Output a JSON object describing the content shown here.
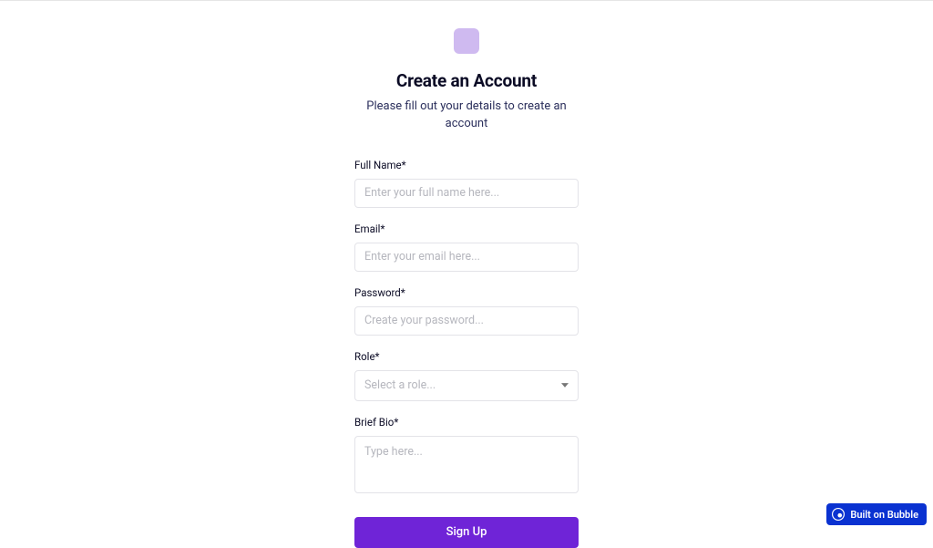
{
  "header": {
    "title": "Create an Account",
    "subtitle": "Please fill out your details to create an account"
  },
  "form": {
    "fullName": {
      "label": "Full Name*",
      "placeholder": "Enter your full name here..."
    },
    "email": {
      "label": "Email*",
      "placeholder": "Enter your email here..."
    },
    "password": {
      "label": "Password*",
      "placeholder": "Create your password..."
    },
    "role": {
      "label": "Role*",
      "placeholder": "Select a role..."
    },
    "bio": {
      "label": "Brief Bio*",
      "placeholder": "Type here..."
    },
    "submitLabel": "Sign Up"
  },
  "badge": {
    "label": "Built on Bubble"
  }
}
